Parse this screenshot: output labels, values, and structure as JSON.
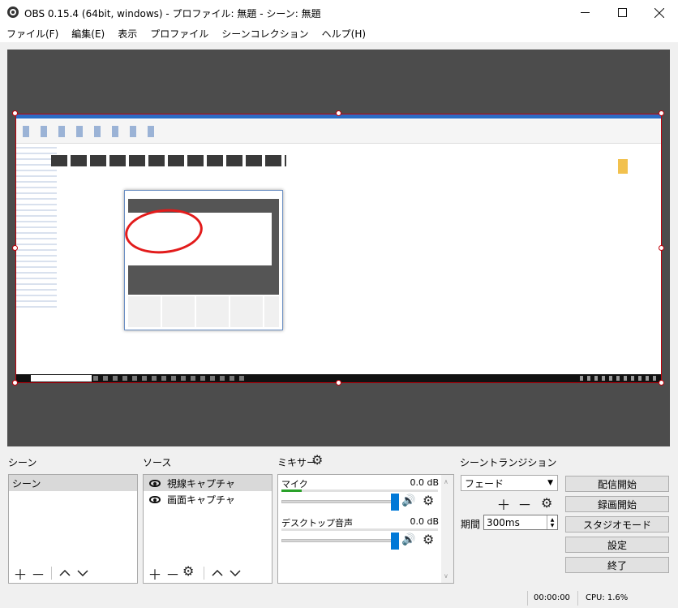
{
  "window": {
    "title": "OBS 0.15.4 (64bit, windows) - プロファイル: 無題 - シーン: 無題",
    "minimize_icon": "minimize-icon",
    "maximize_icon": "maximize-icon",
    "close_icon": "close-icon"
  },
  "menu": {
    "items": [
      "ファイル(F)",
      "編集(E)",
      "表示",
      "プロファイル",
      "シーンコレクション",
      "ヘルプ(H)"
    ]
  },
  "docks": {
    "scenes": {
      "label": "シーン",
      "items": [
        "シーン"
      ],
      "selected_index": 0
    },
    "sources": {
      "label": "ソース",
      "items": [
        {
          "name": "視線キャプチャ",
          "icon": "eye-icon",
          "selected": true
        },
        {
          "name": "画面キャプチャ",
          "icon": "eye-icon",
          "selected": false
        }
      ]
    },
    "mixer": {
      "label": "ミキサー",
      "channels": [
        {
          "name": "マイク",
          "db": "0.0 dB",
          "volume_fraction": 1.0,
          "meter_fraction": 0.13
        },
        {
          "name": "デスクトップ音声",
          "db": "0.0 dB",
          "volume_fraction": 1.0,
          "meter_fraction": 0.0
        }
      ]
    },
    "transitions": {
      "label": "シーントランジション",
      "selected": "フェード",
      "duration_label": "期間",
      "duration_value": "300ms"
    }
  },
  "controls": {
    "start_streaming": "配信開始",
    "start_recording": "録画開始",
    "studio_mode": "スタジオモード",
    "settings": "設定",
    "exit": "終了"
  },
  "status": {
    "time": "00:00:00",
    "cpu": "CPU: 1.6%"
  },
  "colors": {
    "preview_bg": "#4c4c4c",
    "selection_border": "#c0000a",
    "accent_blue": "#0078d7",
    "meter_green": "#2aa12a"
  }
}
